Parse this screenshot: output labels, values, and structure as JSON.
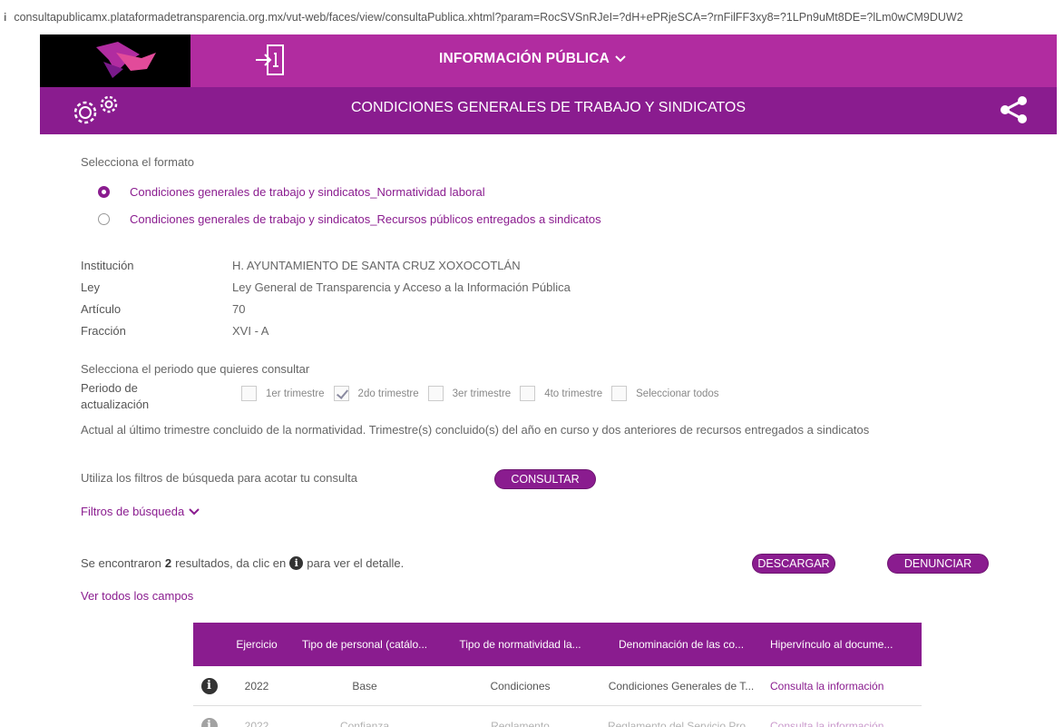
{
  "browser": {
    "url": "consultapublicamx.plataformadetransparencia.org.mx/vut-web/faces/view/consultaPublica.xhtml?param=RocSVSnRJeI=?dH+ePRjeSCA=?rnFilFF3xy8=?1LPn9uMt8DE=?lLm0wCM9DUW2"
  },
  "header": {
    "nav_menu": "INFORMACIÓN PÚBLICA",
    "section_title": "CONDICIONES GENERALES DE TRABAJO Y SINDICATOS"
  },
  "format": {
    "title": "Selecciona el formato",
    "options": [
      {
        "label": "Condiciones generales de trabajo y sindicatos_Normatividad laboral",
        "selected": true
      },
      {
        "label": "Condiciones generales de trabajo y sindicatos_Recursos públicos entregados a sindicatos",
        "selected": false
      }
    ]
  },
  "details": [
    {
      "key": "Institución",
      "value": "H. AYUNTAMIENTO DE SANTA CRUZ XOXOCOTLÁN"
    },
    {
      "key": "Ley",
      "value": "Ley General de Transparencia y Acceso a la Información Pública"
    },
    {
      "key": "Artículo",
      "value": "70"
    },
    {
      "key": "Fracción",
      "value": "XVI - A"
    }
  ],
  "period": {
    "title": "Selecciona el periodo que quieres consultar",
    "label": "Periodo de actualización",
    "options": [
      {
        "label": "1er trimestre",
        "checked": false
      },
      {
        "label": "2do trimestre",
        "checked": true
      },
      {
        "label": "3er trimestre",
        "checked": false
      },
      {
        "label": "4to trimestre",
        "checked": false
      },
      {
        "label": "Seleccionar todos",
        "checked": false
      }
    ],
    "note": "Actual al último trimestre concluido de la normatividad. Trimestre(s) concluido(s) del año en curso y dos anteriores de recursos entregados a sindicatos"
  },
  "search": {
    "hint": "Utiliza los filtros de búsqueda para acotar tu consulta",
    "consult_button": "CONSULTAR",
    "filters_toggle": "Filtros de búsqueda"
  },
  "results": {
    "prefix": "Se encontraron",
    "count": "2",
    "middle": "resultados, da clic en",
    "suffix": "para ver el detalle.",
    "download_button": "DESCARGAR",
    "report_button": "DENUNCIAR",
    "see_all_fields": "Ver todos los campos"
  },
  "table": {
    "headers": [
      "Ejercicio",
      "Tipo de personal (catálo...",
      "Tipo de normatividad la...",
      "Denominación de las co...",
      "Hipervínculo al docume..."
    ],
    "rows": [
      [
        "2022",
        "Base",
        "Condiciones",
        "Condiciones Generales de T...",
        "Consulta la información"
      ],
      [
        "2022",
        "Confianza",
        "Reglamento",
        "Reglamento del Servicio Pro...",
        "Consulta la información"
      ]
    ]
  },
  "colors": {
    "topbar": "#b12ca0",
    "titlebar": "#8a1c8f",
    "accent": "#8a1c8f"
  }
}
